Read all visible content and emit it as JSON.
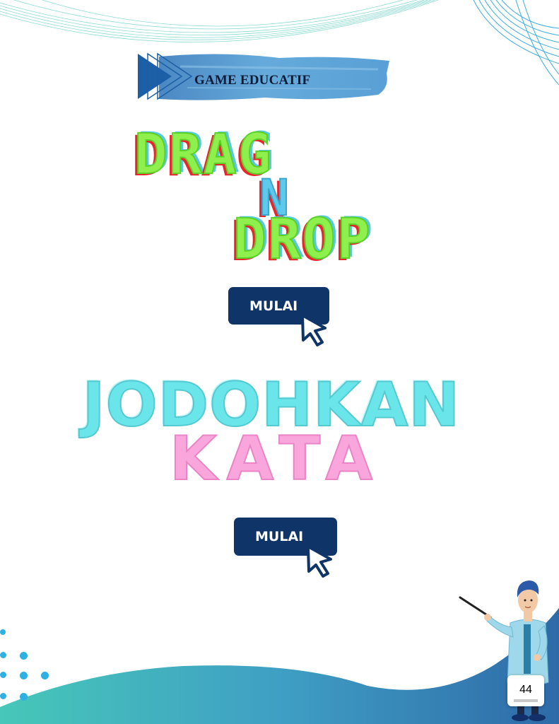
{
  "header": {
    "banner_label": "GAME EDUCATIF"
  },
  "games": [
    {
      "title_parts": [
        "DRAG",
        "N",
        "DROP"
      ],
      "button_label": "MULAI"
    },
    {
      "title_parts": [
        "JODOHKAN",
        "KATA"
      ],
      "button_label": "MULAI"
    }
  ],
  "footer": {
    "page_number": "44"
  },
  "colors": {
    "button_bg": "#0f3468",
    "drag_green": "#8ff04d",
    "drag_red": "#e6262b",
    "drag_cyan": "#5ec9ea",
    "jodohkan_cyan": "#6ae6ea",
    "kata_pink": "#f8a6dc",
    "wave_teal": "#3fc0b8",
    "wave_blue": "#2f6fb0"
  }
}
